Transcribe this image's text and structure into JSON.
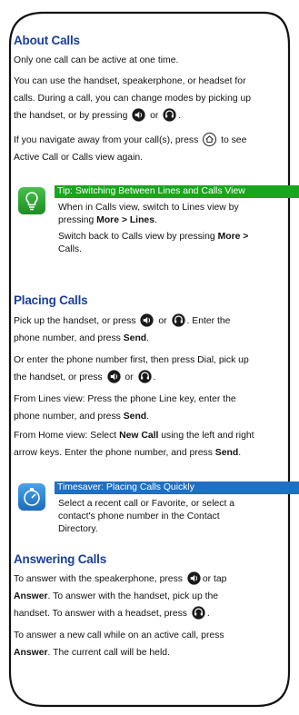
{
  "about": {
    "title": "About Calls",
    "p1": "Only one call can be active at one time.",
    "p2a": "You can use the handset, speakerphone, or headset for",
    "p2b": "calls. During a call, you can change modes by picking up",
    "p2c": "the handset, or by pressing",
    "or": "or",
    "p3a": "If you navigate away from your call(s), press",
    "p3b": "to see",
    "p3c": "Active Call or Calls view again."
  },
  "tip": {
    "header": "Tip: Switching Between Lines and Calls View",
    "l1": "When in Calls view, switch to Lines view by",
    "l2a": "pressing",
    "l2b": "More > Lines",
    "l2c": ".",
    "l3a": "Switch back to Calls view by pressing",
    "l3b": "More >",
    "l4": "Calls",
    "l4b": "."
  },
  "placing": {
    "title": "Placing Calls",
    "p1a": "Pick up the handset, or press",
    "p1b": "or",
    "p1c": ". Enter the",
    "p1d": "phone number, and press",
    "send": "Send",
    "p2a": "Or enter the phone number first, then press Dial, pick up",
    "p2b": "the handset, or press",
    "p3a": "From Lines view: Press the phone Line key, enter the",
    "p3b": "phone number, and press",
    "p4a": "From Home view: Select",
    "newcall": "New Call",
    "p4b": "using the left and right",
    "p4c": "arrow keys. Enter the phone number, and press",
    "dot": "."
  },
  "saver": {
    "header": "Timesaver: Placing Calls Quickly",
    "l1": "Select a recent call or Favorite, or select a",
    "l2": "contact's phone number in the Contact",
    "l3": "Directory."
  },
  "answering": {
    "title": "Answering Calls",
    "p1a": "To answer with the speakerphone, press",
    "p1b": "or tap",
    "answer": "Answer",
    "p1c": ". To answer with the handset, pick up the",
    "p1d": "handset. To answer with a headset, press",
    "p2a": "To answer a new call while on an active call, press",
    "p2b": ". The current call will be held."
  },
  "colors": {
    "heading": "#1b3f9c",
    "tip_bar": "#18a61f",
    "saver_bar": "#1f6fc2",
    "icon_dark": "#1a1a1a"
  }
}
